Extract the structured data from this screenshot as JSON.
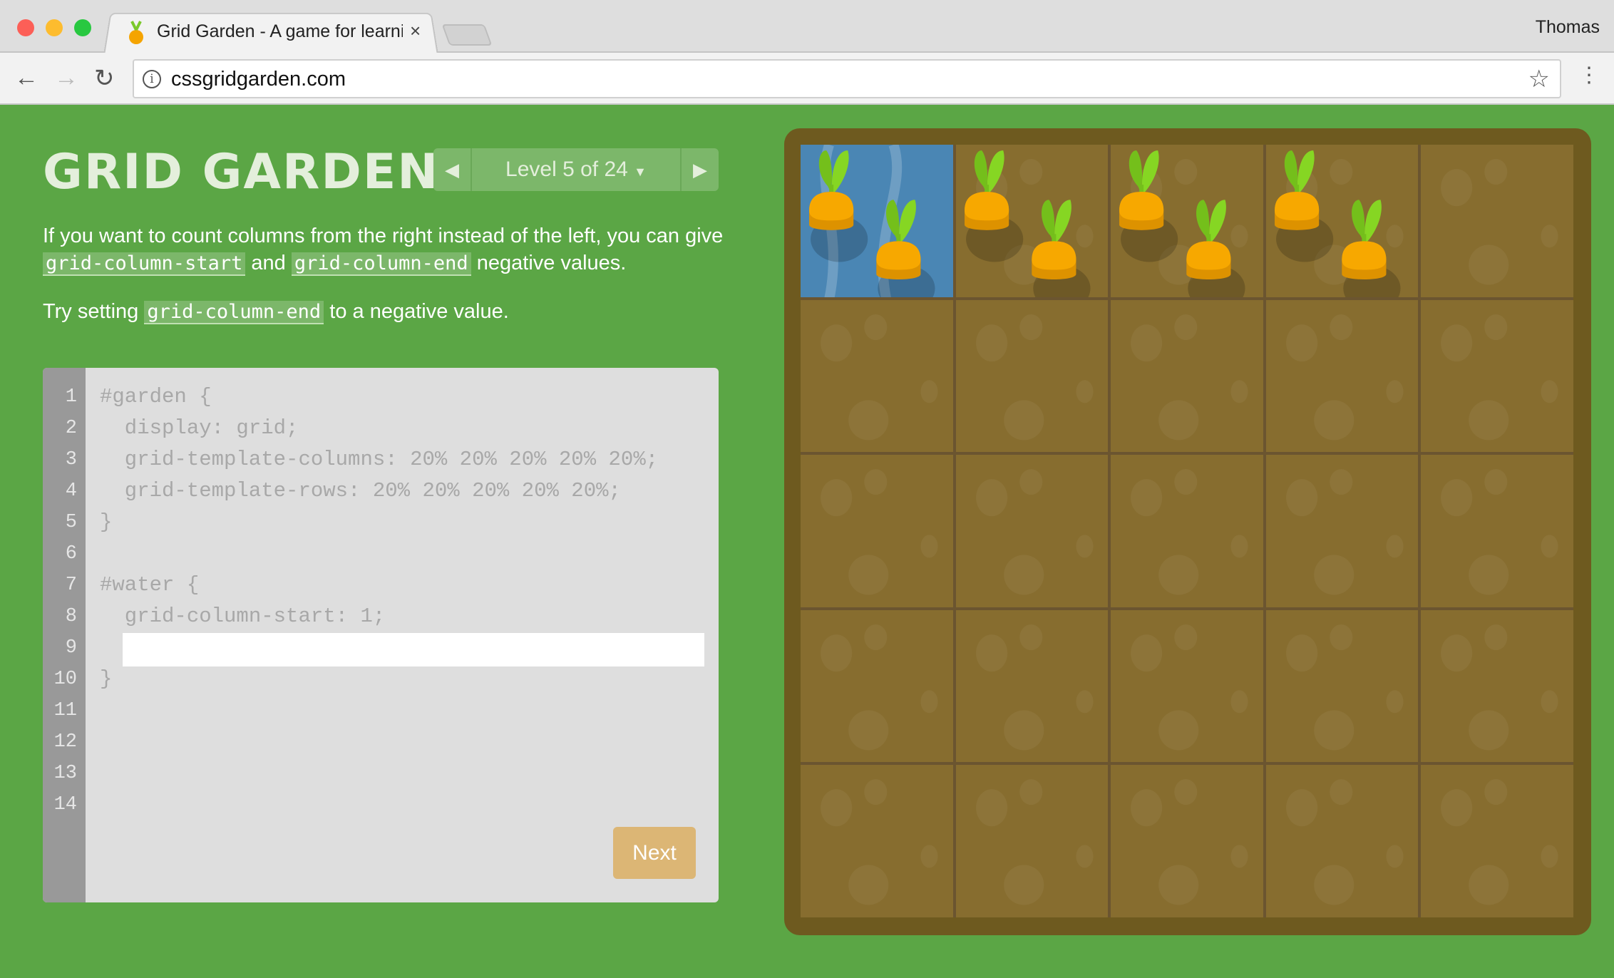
{
  "browser": {
    "tab_title": "Grid Garden - A game for learning CSS grid",
    "user": "Thomas",
    "url": "cssgridgarden.com"
  },
  "header": {
    "title": "GRID GARDEN",
    "level_label": "Level 5 of 24"
  },
  "instructions": {
    "p1_a": "If you want to count columns from the right instead of the left, you can give ",
    "p1_code1": "grid-column-start",
    "p1_b": " and ",
    "p1_code2": "grid-column-end",
    "p1_c": " negative values.",
    "p2_a": "Try setting ",
    "p2_code": "grid-column-end",
    "p2_b": " to a negative value."
  },
  "editor": {
    "line_numbers": [
      "1",
      "2",
      "3",
      "4",
      "5",
      "6",
      "7",
      "8",
      "9",
      "10",
      "11",
      "12",
      "13",
      "14"
    ],
    "lines": [
      "#garden {",
      "  display: grid;",
      "  grid-template-columns: 20% 20% 20% 20% 20%;",
      "  grid-template-rows: 20% 20% 20% 20% 20%;",
      "}",
      "",
      "#water {",
      "  grid-column-start: 1;",
      "",
      "}"
    ],
    "input_value": "",
    "next_label": "Next"
  },
  "garden": {
    "columns": 5,
    "rows": 5,
    "water_cells": [
      [
        1,
        1
      ]
    ],
    "carrot_cells": [
      [
        1,
        1
      ],
      [
        1,
        2
      ],
      [
        1,
        3
      ],
      [
        1,
        4
      ]
    ],
    "colors": {
      "soil": "#876d2f",
      "water": "#4a86b4",
      "border": "#6e5a1f",
      "background": "#5ba645"
    }
  }
}
